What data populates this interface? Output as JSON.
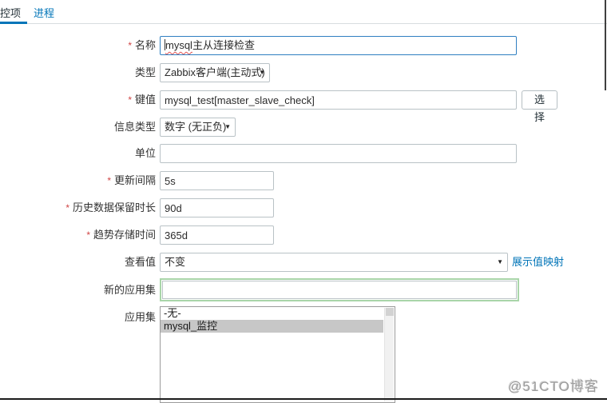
{
  "tabs": {
    "item_tab": "控项",
    "process_tab": "进程"
  },
  "icons": {
    "dropdown_arrow": "▼"
  },
  "form": {
    "name": {
      "required": "*",
      "label": "名称",
      "value_latin": "mysql",
      "value_rest": "主从连接检查"
    },
    "type": {
      "label": "类型",
      "value": "Zabbix客户端(主动式)"
    },
    "key": {
      "required": "*",
      "label": "键值",
      "value": "mysql_test[master_slave_check]",
      "select_button": "选择"
    },
    "info_type": {
      "label": "信息类型",
      "value": "数字 (无正负)"
    },
    "units": {
      "label": "单位",
      "value": ""
    },
    "update_interval": {
      "required": "*",
      "label": "更新间隔",
      "value": "5s"
    },
    "history": {
      "required": "*",
      "label": "历史数据保留时长",
      "value": "90d"
    },
    "trends": {
      "required": "*",
      "label": "趋势存储时间",
      "value": "365d"
    },
    "show_value": {
      "label": "查看值",
      "value": "不变",
      "link": "展示值映射"
    },
    "new_application": {
      "label": "新的应用集",
      "value": ""
    },
    "applications": {
      "label": "应用集",
      "options": [
        {
          "label": "-无-",
          "selected": false
        },
        {
          "label": "mysql_监控",
          "selected": true
        }
      ]
    }
  },
  "watermark": "@51CTO博客"
}
